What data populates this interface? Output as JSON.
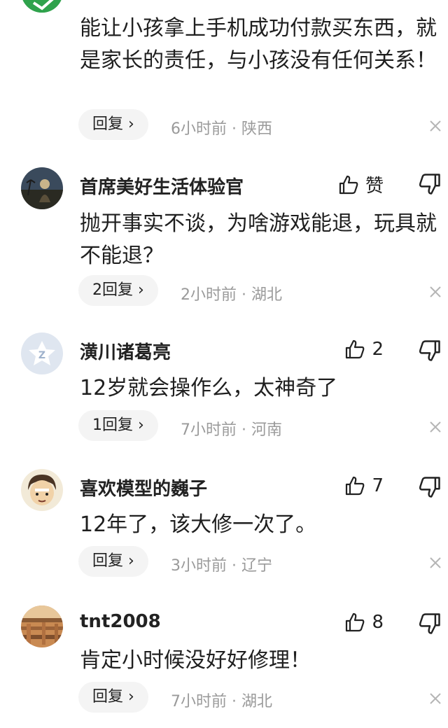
{
  "comments": [
    {
      "content": "能让小孩拿上手机成功付款买东西，就是家长的责任，与小孩没有任何关系！",
      "reply_label": "回复 ›",
      "meta": "6小时前 · 陕西"
    },
    {
      "username": "首席美好生活体验官",
      "like_label": "赞",
      "content": "抛开事实不谈，为啥游戏能退，玩具就不能退？",
      "reply_label": "2回复 ›",
      "meta": "2小时前 · 湖北"
    },
    {
      "username": "潢川诸葛亮",
      "like_label": "2",
      "content": "12岁就会操作么，太神奇了",
      "reply_label": "1回复 ›",
      "meta": "7小时前 · 河南"
    },
    {
      "username": "喜欢模型的巍子",
      "like_label": "7",
      "content": "12年了，该大修一次了。",
      "reply_label": "回复 ›",
      "meta": "3小时前 · 辽宁"
    },
    {
      "username": "tnt2008",
      "like_label": "8",
      "content": "肯定小时候没好好修理！",
      "reply_label": "回复 ›",
      "meta": "7小时前 · 湖北"
    }
  ],
  "icons": {
    "like": "thumbs-up-icon",
    "dislike": "thumbs-down-icon",
    "close": "close-icon"
  },
  "colors": {
    "text": "#1f1f1f",
    "meta": "#9a9a9a",
    "pill_bg": "#f4f4f4"
  }
}
